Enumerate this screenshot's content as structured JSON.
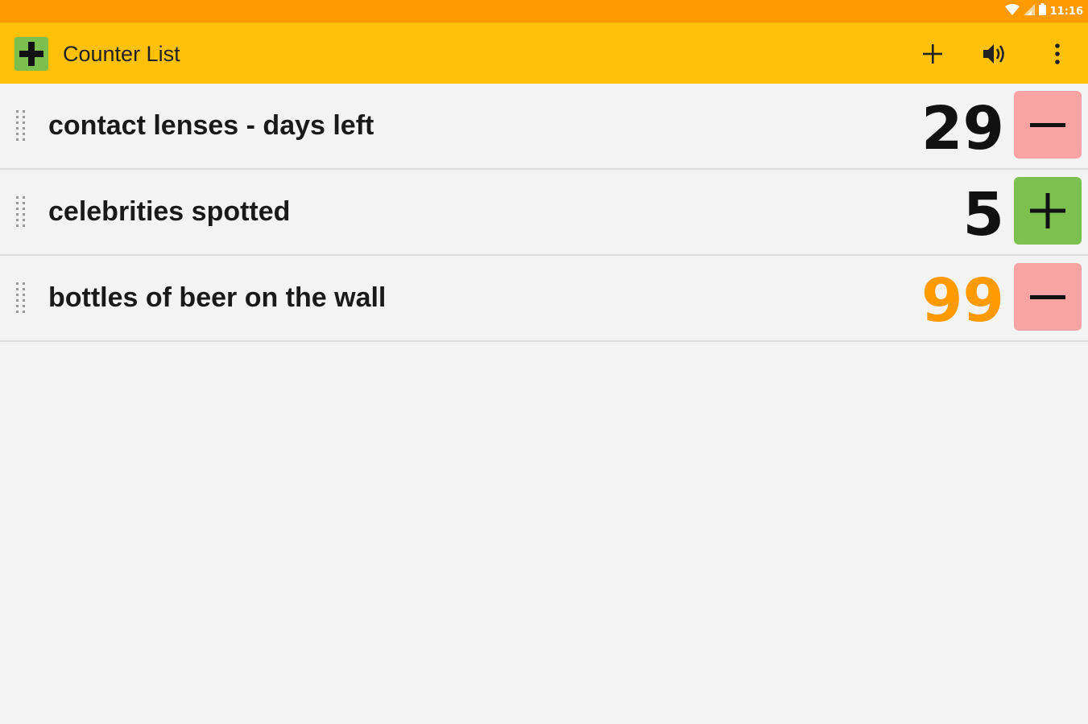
{
  "status_bar": {
    "time": "11:16",
    "background": "#ff9a00",
    "icons": [
      "wifi-icon",
      "signal-icon",
      "battery-icon"
    ]
  },
  "app_bar": {
    "title": "Counter List",
    "background": "#ffc107",
    "logo_icon": "green-plus-icon",
    "actions": [
      {
        "name": "add-counter",
        "icon": "plus-icon"
      },
      {
        "name": "sound-toggle",
        "icon": "volume-icon"
      },
      {
        "name": "overflow-menu",
        "icon": "more-vert-icon"
      }
    ]
  },
  "counters": [
    {
      "label": "contact lenses - days left",
      "count": "29",
      "count_color": "#111111",
      "button": "minus",
      "button_color": "#f9a3a3"
    },
    {
      "label": "celebrities spotted",
      "count": "5",
      "count_color": "#111111",
      "button": "plus",
      "button_color": "#7cc150"
    },
    {
      "label": "bottles of beer on the wall",
      "count": "99",
      "count_color": "#ff9a00",
      "button": "minus",
      "button_color": "#f9a3a3"
    }
  ]
}
